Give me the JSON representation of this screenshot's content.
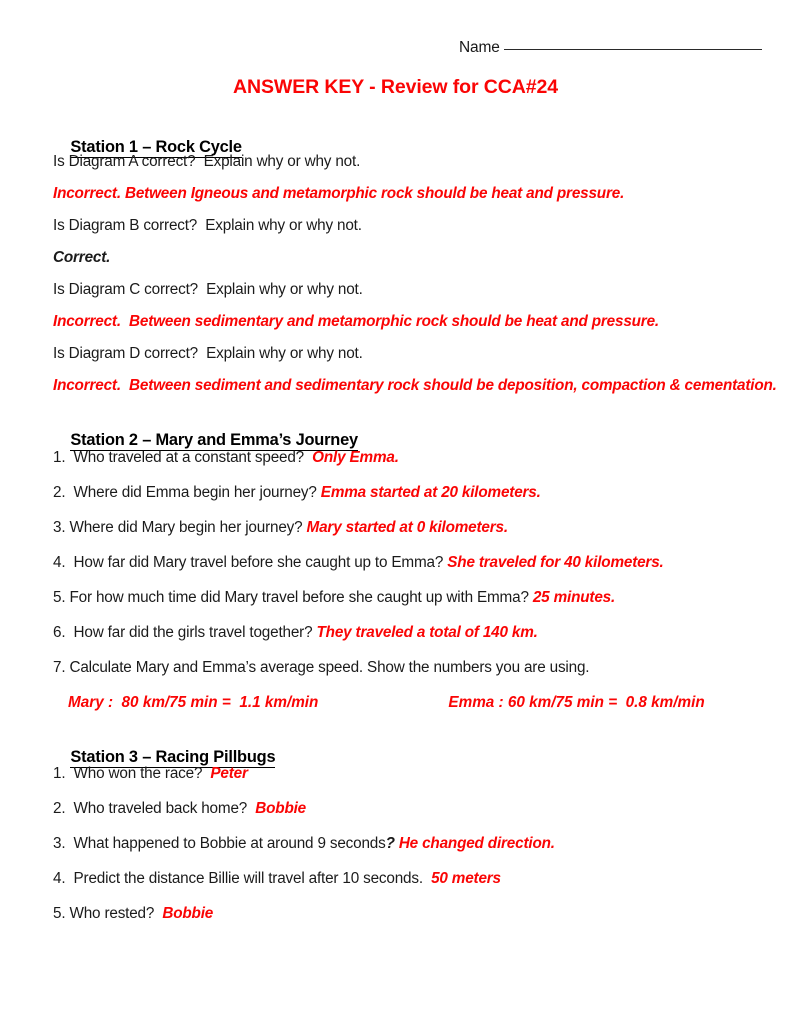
{
  "header": {
    "name_label": "Name",
    "name_blank": "______________________________"
  },
  "title": "ANSWER KEY - Review for CCA#24",
  "colors": {
    "answer_red": "#FA0505",
    "body_black": "#1B1B1B"
  },
  "sections": [
    {
      "heading": "Station 1 – Rock Cycle",
      "items": [
        {
          "question": "Is Diagram A correct?  Explain why or why not.",
          "answer": "Incorrect. Between Igneous and metamorphic rock should be heat and pressure.",
          "answer_style": "red"
        },
        {
          "question": "Is Diagram B correct?  Explain why or why not.",
          "answer": "Correct.",
          "answer_style": "black"
        },
        {
          "question": "Is Diagram C correct?  Explain why or why not.",
          "answer": "Incorrect.  Between sedimentary and metamorphic rock should be heat and pressure.",
          "answer_style": "red"
        },
        {
          "question": "Is Diagram D correct?  Explain why or why not.",
          "answer": "Incorrect.  Between sediment and sedimentary rock should be deposition, compaction & cementation.",
          "answer_style": "red"
        }
      ]
    },
    {
      "heading": "Station 2 – Mary and Emma’s Journey",
      "items": [
        {
          "question": "1.  Who traveled at a constant speed? ",
          "answer": " Only Emma."
        },
        {
          "question": "2.  Where did Emma begin her journey? ",
          "answer": "Emma started at 20 kilometers."
        },
        {
          "question": "3. Where did Mary begin her journey? ",
          "answer": "Mary started at 0 kilometers."
        },
        {
          "question": "4.  How far did Mary travel before she caught up to Emma? ",
          "answer": "She traveled for 40 kilometers."
        },
        {
          "question": "5. For how much time did Mary travel before she caught up with Emma? ",
          "answer": "25 minutes."
        },
        {
          "question": "6.  How far did the girls travel together? ",
          "answer": "They traveled a total of 140 km."
        },
        {
          "question": "7. Calculate Mary and Emma’s average speed. Show the numbers you are using.",
          "answer": ""
        }
      ],
      "calc": {
        "mary": "Mary :  80 km/75 min =  1.1 km/min",
        "emma": "Emma : 60 km/75 min =  0.8 km/min"
      }
    },
    {
      "heading": "Station 3 – Racing Pillbugs",
      "items": [
        {
          "question": "1.  Who won the race? ",
          "answer": " Peter"
        },
        {
          "question": "2.  Who traveled back home? ",
          "answer": " Bobbie"
        },
        {
          "question": "3.  What happened to Bobbie at around 9 seconds",
          "mark": "?",
          "answer": " He changed direction."
        },
        {
          "question": "4.  Predict the distance Billie will travel after 10 seconds. ",
          "answer": " 50 meters"
        },
        {
          "question": "5. Who rested? ",
          "answer": " Bobbie"
        }
      ]
    }
  ]
}
